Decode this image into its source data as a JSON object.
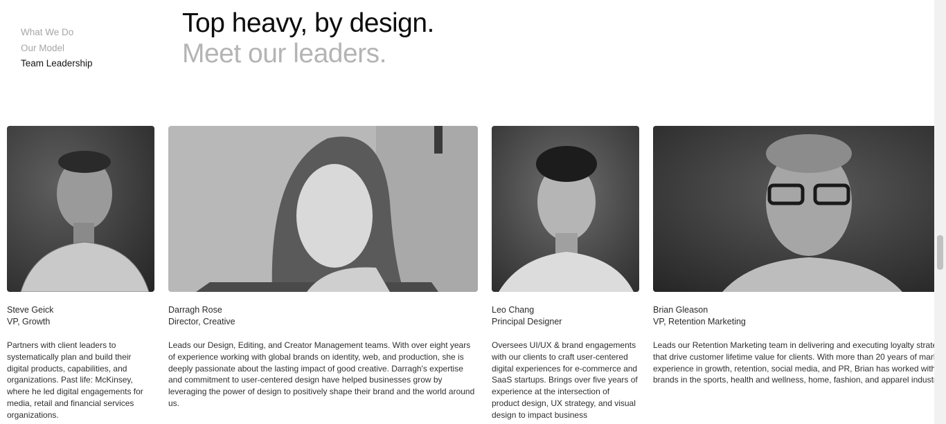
{
  "nav": {
    "items": [
      {
        "label": "What We Do"
      },
      {
        "label": "Our Model"
      },
      {
        "label": "Team Leadership"
      }
    ]
  },
  "heading": {
    "line1": "Top heavy, by design.",
    "line2": "Meet our leaders."
  },
  "leaders": [
    {
      "name": "Steve Geick",
      "role": "VP, Growth",
      "bio": "Partners with client leaders to systematically plan and build their digital products, capabilities, and organizations. Past life: McKinsey, where he led digital engagements for media, retail and financial services organizations."
    },
    {
      "name": "Darragh Rose",
      "role": "Director, Creative",
      "bio": "Leads our Design, Editing, and Creator Management teams. With over eight years of experience working with global brands on identity, web, and production, she is deeply passionate about the lasting impact of good creative. Darragh's expertise and commitment to user-centered design have helped businesses grow by leveraging the power of design to positively shape their brand and the world around us."
    },
    {
      "name": "Leo Chang",
      "role": "Principal Designer",
      "bio": "Oversees UI/UX & brand engagements with our clients to craft user-centered digital experiences for e-commerce and SaaS startups. Brings over five years of experience at the intersection of product design, UX strategy, and visual design to impact business"
    },
    {
      "name": "Brian Gleason",
      "role": "VP, Retention Marketing",
      "bio": "Leads our Retention Marketing team in delivering and executing loyalty strategies that drive customer lifetime value for clients. With more than 20 years of marketing experience in growth, retention, social media, and PR, Brian has worked with global brands in the sports, health and wellness, home, fashion, and apparel industries."
    }
  ]
}
